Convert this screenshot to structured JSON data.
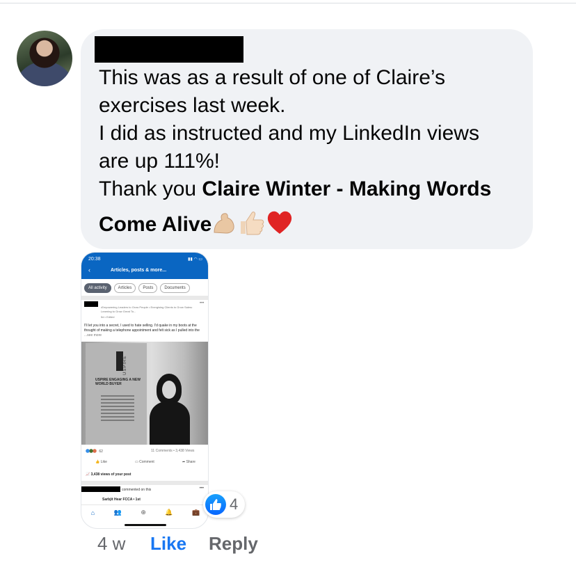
{
  "comment": {
    "lines": [
      "This was as a result of one of Claire’s",
      "exercises last week.",
      "I did as instructed and my LinkedIn views",
      "are up 111%!"
    ],
    "thanks_prefix": "Thank you ",
    "mention": "Claire Winter - Making Words",
    "mention_cont": "Come Alive",
    "emoji_icons": [
      "flexed-biceps-emoji",
      "thumbs-up-emoji",
      "red-heart-emoji"
    ]
  },
  "screenshot": {
    "time": "20:38",
    "header_title": "Articles, posts & more...",
    "chips": [
      "All activity",
      "Articles",
      "Posts",
      "Documents"
    ],
    "post_subtitle": "•Empowering Leaders to Grow People • Energising Clients to Grow Sales• Learning to Grow Great To...",
    "post_meta": "5d • Edited",
    "post_body": "I'll let you into a secret, I used to hate selling. I'd quake in my boots at the thought of making a telephone appointment and felt sick as I pulled into the",
    "see_more": "...see more",
    "banner_brand": "USPIRE",
    "banner_text": "USPIRE ENGAGING A NEW WORLD BUYER",
    "reactions_count": "62",
    "stats": "11 Comments • 3,438 Views",
    "actions": [
      "Like",
      "Comment",
      "Share"
    ],
    "views": "3,438 views of your post",
    "commented": "commented on this",
    "commenter": "Sarbjit Hear FCCA • 1st"
  },
  "reaction": {
    "icon": "like-icon",
    "count": "4"
  },
  "footer": {
    "time": "4 w",
    "like": "Like",
    "reply": "Reply"
  }
}
